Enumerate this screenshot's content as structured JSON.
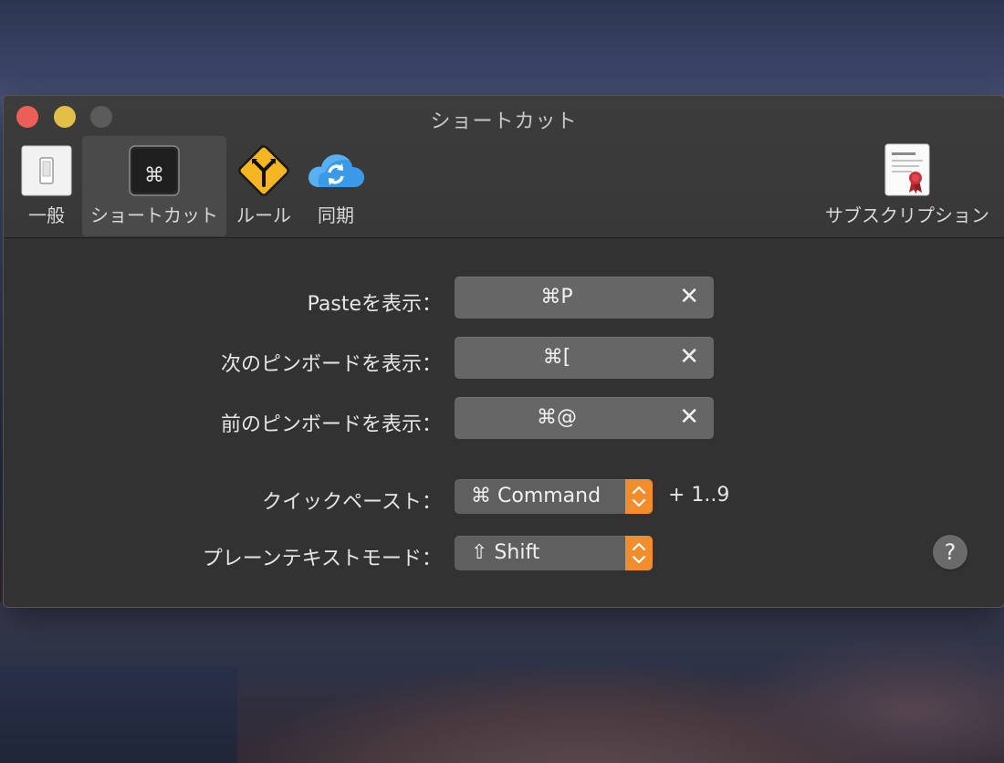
{
  "window": {
    "title": "ショートカット"
  },
  "tabs": [
    {
      "label": "一般",
      "icon": "switch-icon"
    },
    {
      "label": "ショートカット",
      "icon": "command-key-icon",
      "glyph": "⌘"
    },
    {
      "label": "ルール",
      "icon": "road-sign-icon"
    },
    {
      "label": "同期",
      "icon": "icloud-sync-icon"
    },
    {
      "label": "サブスクリプション",
      "icon": "certificate-icon"
    }
  ],
  "shortcuts": [
    {
      "label": "Pasteを表示：",
      "value": "⌘P",
      "clear": "✕"
    },
    {
      "label": "次のピンボードを表示：",
      "value": "⌘[",
      "clear": "✕"
    },
    {
      "label": "前のピンボードを表示：",
      "value": "⌘@",
      "clear": "✕"
    }
  ],
  "quick_paste": {
    "label": "クイックペースト：",
    "value": "⌘ Command",
    "suffix": "+  1..9"
  },
  "plain_text": {
    "label": "プレーンテキストモード：",
    "value": "⇧ Shift"
  },
  "help": {
    "label": "?"
  },
  "colors": {
    "accent": "#f28d2e",
    "close": "#ec5f56",
    "minimize": "#e2bf46",
    "zoom_inactive": "#5b5b5b"
  }
}
